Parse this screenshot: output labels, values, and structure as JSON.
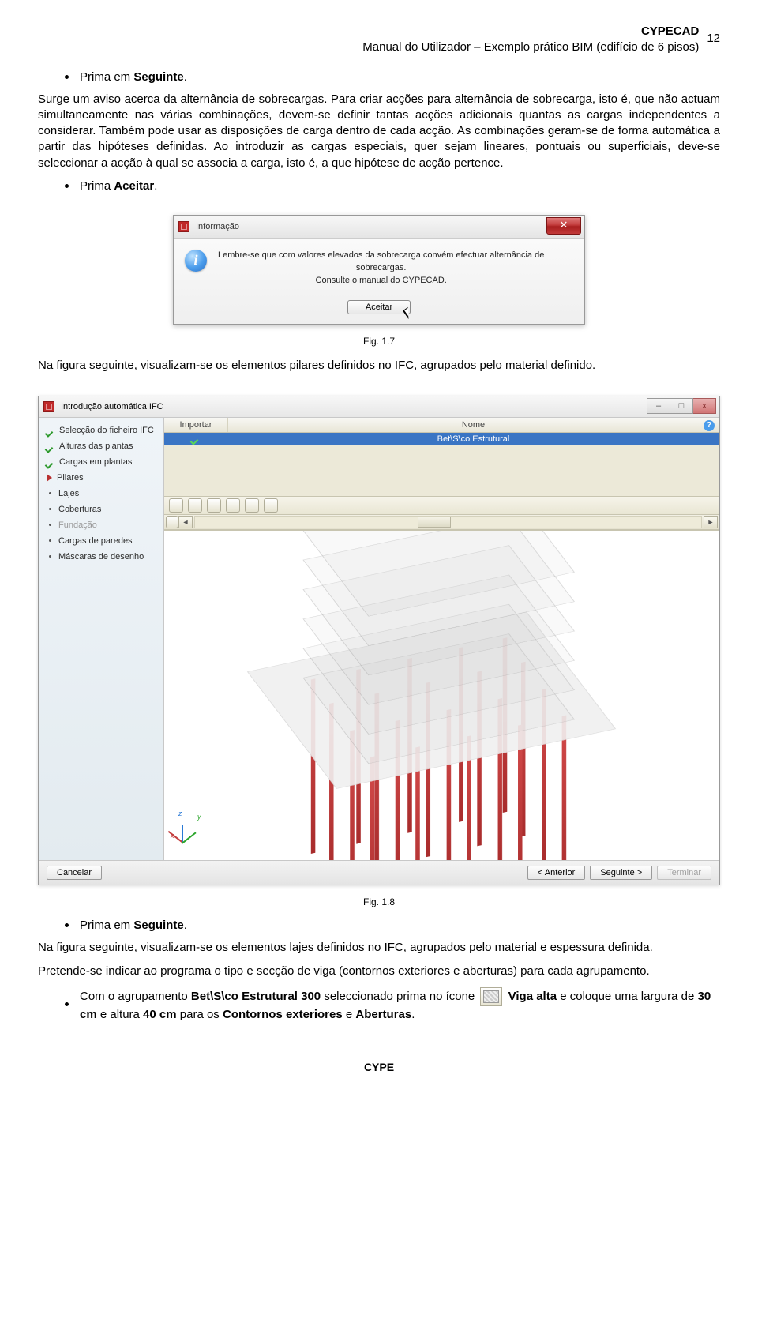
{
  "header": {
    "title": "CYPECAD",
    "subtitle": "Manual do Utilizador – Exemplo prático BIM (edifício de 6 pisos)",
    "page_number": "12"
  },
  "bullets": {
    "b1_prefix": "Prima em ",
    "b1_bold": "Seguinte",
    "b1_suffix": ".",
    "b2_prefix": "Prima ",
    "b2_bold": "Aceitar",
    "b2_suffix": ".",
    "b3_prefix": "Prima em ",
    "b3_bold": "Seguinte",
    "b3_suffix": ".",
    "b4_seg1": "Com o agrupamento ",
    "b4_bold1": "Bet\\S\\co Estrutural 300",
    "b4_seg2": " seleccionado prima no ícone ",
    "b4_bold2": "Viga alta",
    "b4_seg3": " e coloque uma largura de ",
    "b4_bold3": "30 cm",
    "b4_seg4": " e altura ",
    "b4_bold4": "40 cm",
    "b4_seg5": " para os ",
    "b4_bold5": "Contornos exteriores",
    "b4_seg6": " e ",
    "b4_bold6": "Aberturas",
    "b4_seg7": "."
  },
  "paras": {
    "p1": "Surge um aviso acerca da alternância de sobrecargas. Para criar acções para alternância de sobrecarga, isto é, que não actuam simultaneamente nas várias combinações, devem-se definir tantas acções adicionais quantas as cargas independentes a considerar. Também pode usar as disposições de carga dentro de cada acção. As combinações geram-se de forma automática a partir das hipóteses definidas. Ao introduzir as cargas especiais, quer sejam lineares, pontuais ou superficiais, deve-se seleccionar a acção à qual se associa a carga, isto é, a que hipótese de acção pertence.",
    "p2": "Na figura seguinte, visualizam-se os elementos pilares definidos no IFC, agrupados pelo material definido.",
    "p3": "Na figura seguinte, visualizam-se os elementos lajes definidos no IFC, agrupados pelo material e espessura definida.",
    "p4": "Pretende-se indicar ao programa o tipo e secção de viga (contornos exteriores e aberturas) para cada agrupamento."
  },
  "dialog1": {
    "title": "Informação",
    "line1": "Lembre-se que com valores elevados da sobrecarga convém efectuar alternância de",
    "line2": "sobrecargas.",
    "line3": "Consulte o manual do CYPECAD.",
    "btn_aceitar": "Aceitar",
    "close_glyph": "✕"
  },
  "captions": {
    "fig17": "Fig. 1.7",
    "fig18": "Fig. 1.8"
  },
  "dialog2": {
    "title": "Introdução automática IFC",
    "sidebar": [
      {
        "icon": "check",
        "label": "Selecção do ficheiro IFC"
      },
      {
        "icon": "check",
        "label": "Alturas das plantas"
      },
      {
        "icon": "check",
        "label": "Cargas em plantas"
      },
      {
        "icon": "tri",
        "label": "Pilares"
      },
      {
        "icon": "dot",
        "label": "Lajes"
      },
      {
        "icon": "dot",
        "label": "Coberturas"
      },
      {
        "icon": "dot",
        "label": "Fundação",
        "disabled": true
      },
      {
        "icon": "dot",
        "label": "Cargas de paredes"
      },
      {
        "icon": "dot",
        "label": "Máscaras de desenho"
      }
    ],
    "table": {
      "col_importar": "Importar",
      "col_nome": "Nome",
      "row_nome": "Bet\\S\\co Estrutural"
    },
    "help_glyph": "?",
    "win_min": "–",
    "win_max": "□",
    "win_close": "x",
    "scroll_left": "◄",
    "scroll_right": "►",
    "footer": {
      "cancelar": "Cancelar",
      "anterior": "< Anterior",
      "seguinte": "Seguinte >",
      "terminar": "Terminar"
    }
  },
  "footer_brand": "CYPE"
}
